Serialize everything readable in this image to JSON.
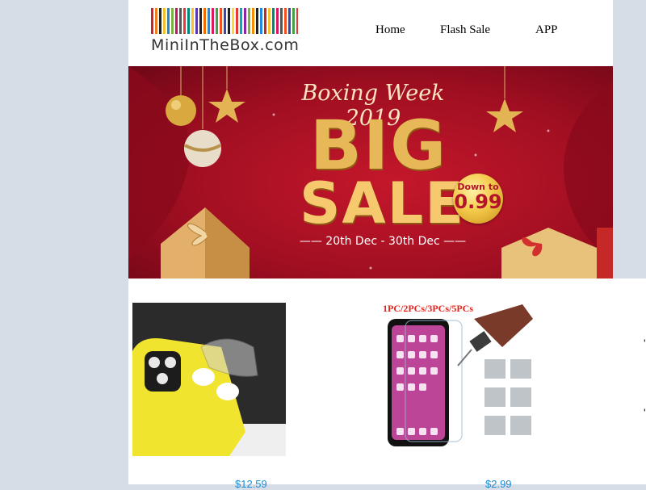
{
  "brand": {
    "name": "MiniInTheBox.com"
  },
  "nav": [
    {
      "label": "Home"
    },
    {
      "label": "Flash Sale"
    },
    {
      "label": "APP"
    }
  ],
  "banner": {
    "title": "Boxing Week 2019",
    "big": "BIG",
    "sale": "SALE",
    "badge_top": "Down to",
    "badge_price": "0.99",
    "dates": "—— 20th Dec - 30th Dec ——"
  },
  "products": [
    {
      "image": "yellow-phone-case-airpods-holder",
      "price": "$12.59"
    },
    {
      "image": "screen-protector-glass",
      "tag": "1PC/2PCs/3PCs/5PCs",
      "price": "$2.99"
    }
  ],
  "side_fragment": {
    "glyph_top": "'",
    "glyph_bottom": "'"
  },
  "colors": {
    "banner_red": "#b31226",
    "gold": "#e7b857",
    "link_blue": "#1a8cd8"
  }
}
